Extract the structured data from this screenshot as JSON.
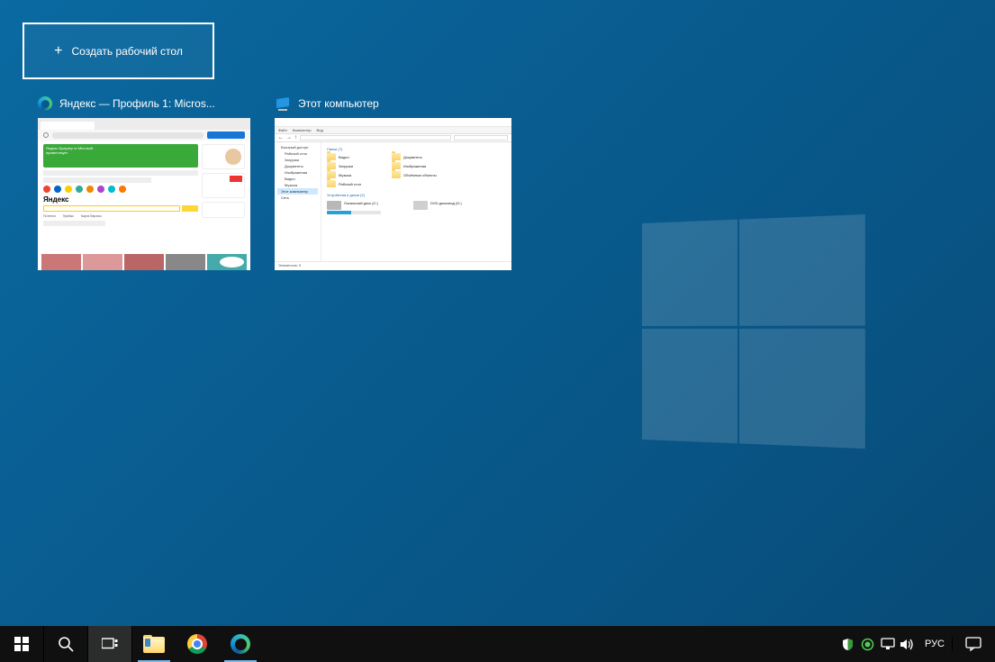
{
  "newDesktop": {
    "label": "Создать рабочий стол"
  },
  "tasks": {
    "edge": {
      "title": "Яндекс — Профиль 1: Micros...",
      "yandexLogo": "Яндекс",
      "news1": "Потепло",
      "news2": "Прибас"
    },
    "explorer": {
      "title": "Этот компьютер",
      "ribbon1": "Файл",
      "ribbon2": "Компьютер",
      "ribbon3": "Вид",
      "group_folders": "Папки (7)",
      "f1": "Видео",
      "f2": "Документы",
      "f3": "Загрузки",
      "f4": "Изображения",
      "f5": "Музыка",
      "f6": "Объёмные объекты",
      "f7": "Рабочий стол",
      "group_drives": "Устройства и диски (2)",
      "drive1": "Локальный диск (C:)",
      "drive2": "DVD-дисковод (D:)",
      "nav_quick": "Быстрый доступ",
      "nav_desk": "Рабочий стол",
      "nav_dl": "Загрузки",
      "nav_docs": "Документы",
      "nav_pics": "Изображения",
      "nav_vid": "Видео",
      "nav_mus": "Музыка",
      "nav_pc": "Этот компьютер",
      "nav_net": "Сеть",
      "status": "Элементов: 9"
    }
  },
  "tray": {
    "lang": "РУС"
  }
}
